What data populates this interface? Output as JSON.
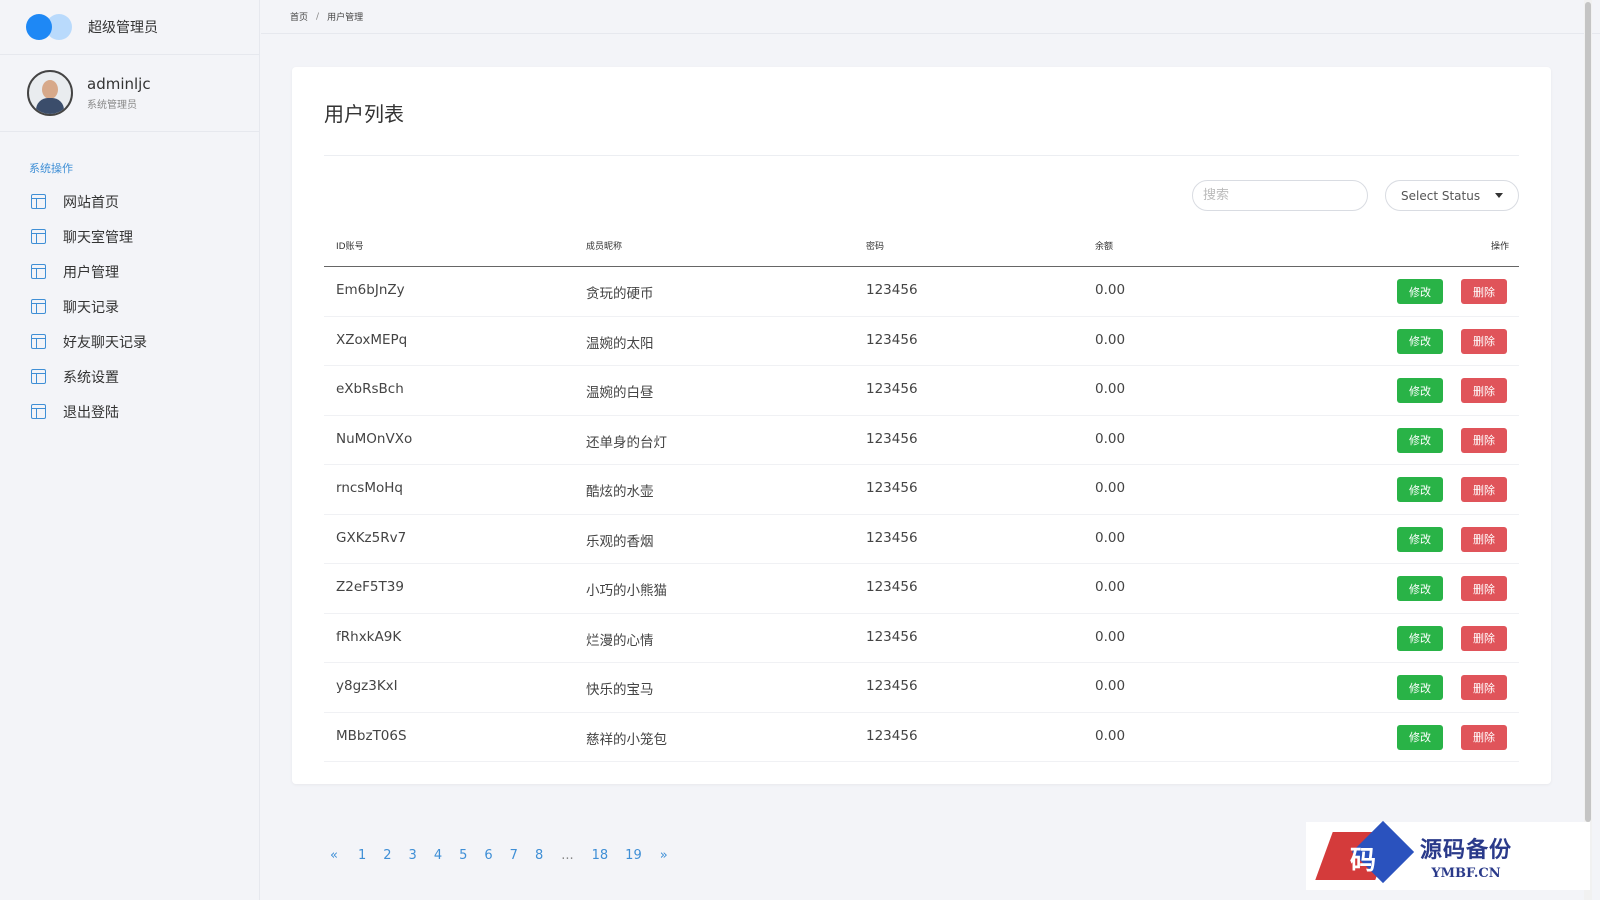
{
  "sidebar": {
    "brand_title": "超级管理员",
    "user": {
      "name": "adminljc",
      "role": "系统管理员"
    },
    "section_title": "系统操作",
    "items": [
      {
        "label": "网站首页"
      },
      {
        "label": "聊天室管理"
      },
      {
        "label": "用户管理"
      },
      {
        "label": "聊天记录"
      },
      {
        "label": "好友聊天记录"
      },
      {
        "label": "系统设置"
      },
      {
        "label": "退出登陆"
      }
    ]
  },
  "breadcrumb": {
    "home": "首页",
    "separator": "/",
    "current": "用户管理"
  },
  "card": {
    "title": "用户列表",
    "search_placeholder": "搜索",
    "status_select": "Select Status"
  },
  "table": {
    "headers": {
      "id": "ID账号",
      "nickname": "成员昵称",
      "password": "密码",
      "balance": "余额",
      "actions": "操作"
    },
    "edit_label": "修改",
    "delete_label": "删除",
    "rows": [
      {
        "id": "Em6bJnZy",
        "nickname": "贪玩的硬币",
        "password": "123456",
        "balance": "0.00"
      },
      {
        "id": "XZoxMEPq",
        "nickname": "温婉的太阳",
        "password": "123456",
        "balance": "0.00"
      },
      {
        "id": "eXbRsBch",
        "nickname": "温婉的白昼",
        "password": "123456",
        "balance": "0.00"
      },
      {
        "id": "NuMOnVXo",
        "nickname": "还单身的台灯",
        "password": "123456",
        "balance": "0.00"
      },
      {
        "id": "rncsMoHq",
        "nickname": "酷炫的水壶",
        "password": "123456",
        "balance": "0.00"
      },
      {
        "id": "GXKz5Rv7",
        "nickname": "乐观的香烟",
        "password": "123456",
        "balance": "0.00"
      },
      {
        "id": "Z2eF5T39",
        "nickname": "小巧的小熊猫",
        "password": "123456",
        "balance": "0.00"
      },
      {
        "id": "fRhxkA9K",
        "nickname": "烂漫的心情",
        "password": "123456",
        "balance": "0.00"
      },
      {
        "id": "y8gz3KxI",
        "nickname": "快乐的宝马",
        "password": "123456",
        "balance": "0.00"
      },
      {
        "id": "MBbzT06S",
        "nickname": "慈祥的小笼包",
        "password": "123456",
        "balance": "0.00"
      }
    ]
  },
  "pagination": {
    "prev": "«",
    "pages": [
      "1",
      "2",
      "3",
      "4",
      "5",
      "6",
      "7",
      "8",
      "...",
      "18",
      "19"
    ],
    "next": "»"
  },
  "watermark": {
    "logo_char": "码",
    "cn": "源码备份",
    "en": "YMBF.CN"
  },
  "colors": {
    "accent": "#3f8fd6",
    "edit": "#29b347",
    "delete": "#e0545a",
    "brand": "#1e88f5"
  }
}
